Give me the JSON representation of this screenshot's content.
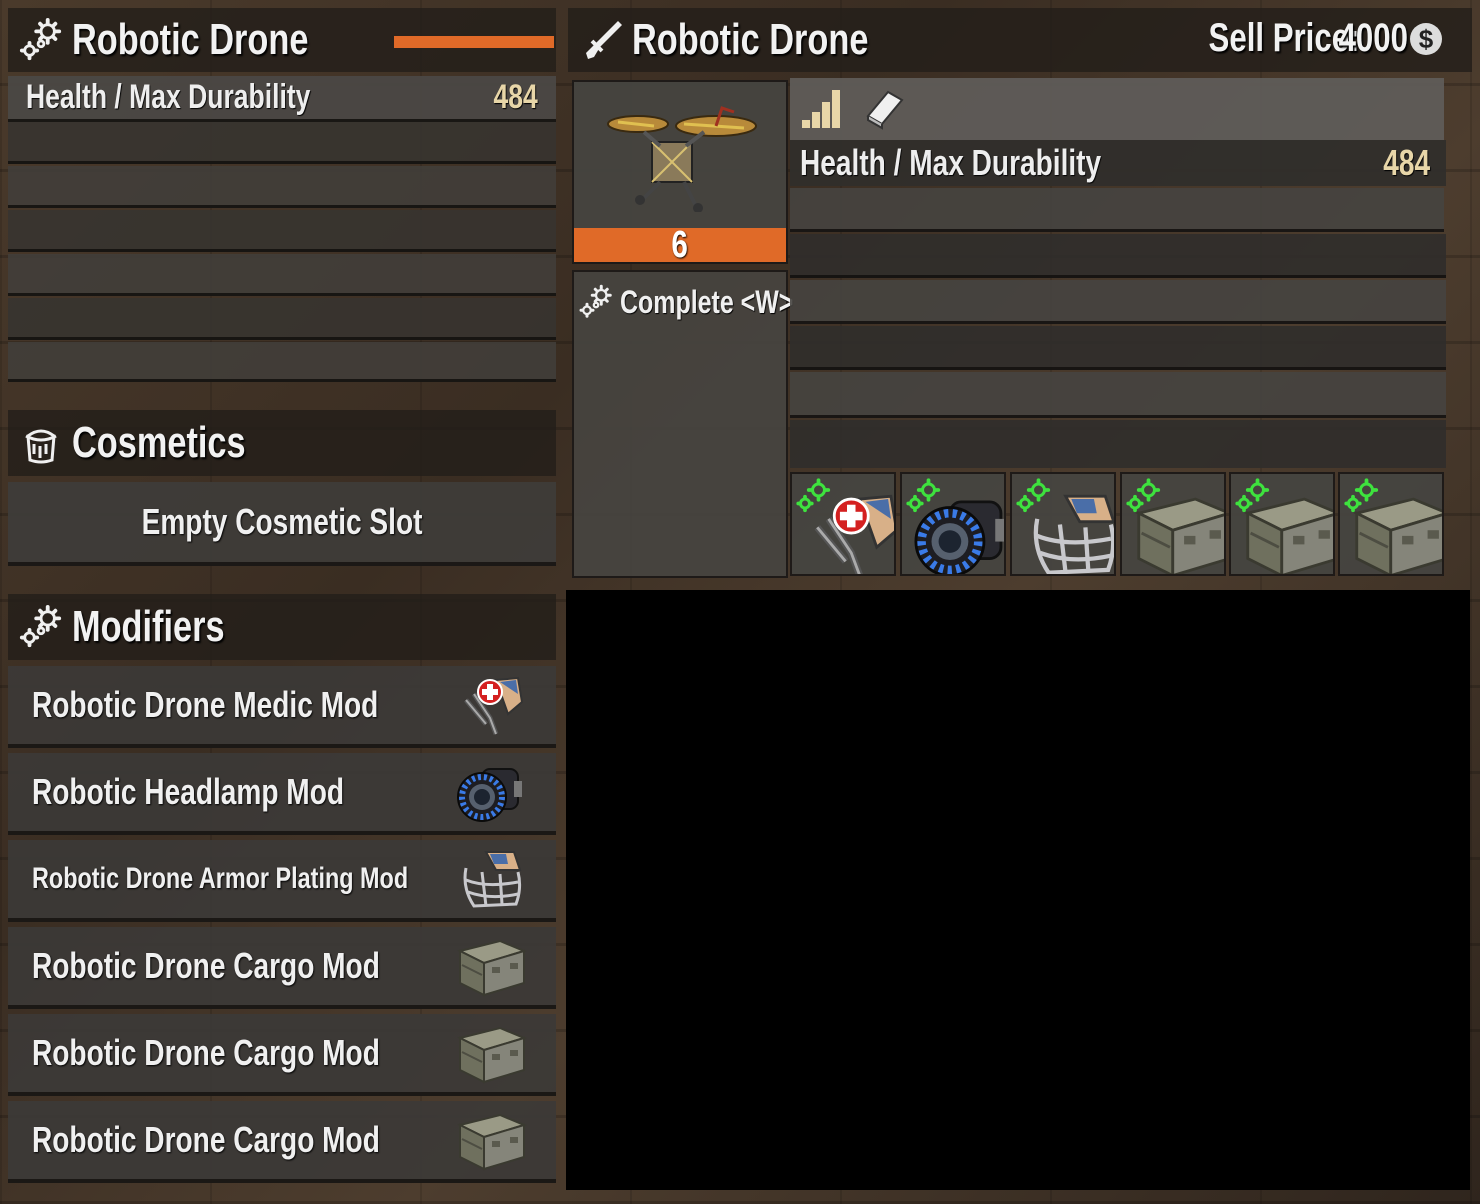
{
  "left": {
    "title": "Robotic Drone",
    "bar_color": "#e06a28",
    "stats": [
      {
        "label": "Health / Max Durability",
        "value": "484"
      }
    ],
    "cosmetics": {
      "title": "Cosmetics",
      "empty_slot": "Empty Cosmetic Slot"
    },
    "modifiers": {
      "title": "Modifiers",
      "items": [
        {
          "label": "Robotic Drone Medic Mod",
          "icon": "medic-mod-icon"
        },
        {
          "label": "Robotic Headlamp Mod",
          "icon": "headlamp-mod-icon"
        },
        {
          "label": "Robotic Drone Armor Plating Mod",
          "icon": "armor-mod-icon"
        },
        {
          "label": "Robotic Drone Cargo Mod",
          "icon": "cargo-mod-icon"
        },
        {
          "label": "Robotic Drone Cargo Mod",
          "icon": "cargo-mod-icon"
        },
        {
          "label": "Robotic Drone Cargo Mod",
          "icon": "cargo-mod-icon"
        }
      ]
    }
  },
  "right": {
    "title": "Robotic Drone",
    "sell_price_label": "Sell Price:",
    "sell_price_value": "4000",
    "coin_icon": "$",
    "item_count": "6",
    "count_bar_color": "#e06a28",
    "action_label": "Complete <W>",
    "stats": [
      {
        "label": "Health / Max Durability",
        "value": "484"
      }
    ],
    "mod_slots": [
      "medic-mod-icon",
      "headlamp-mod-icon",
      "armor-mod-icon",
      "cargo-mod-icon",
      "cargo-mod-icon",
      "cargo-mod-icon"
    ]
  }
}
